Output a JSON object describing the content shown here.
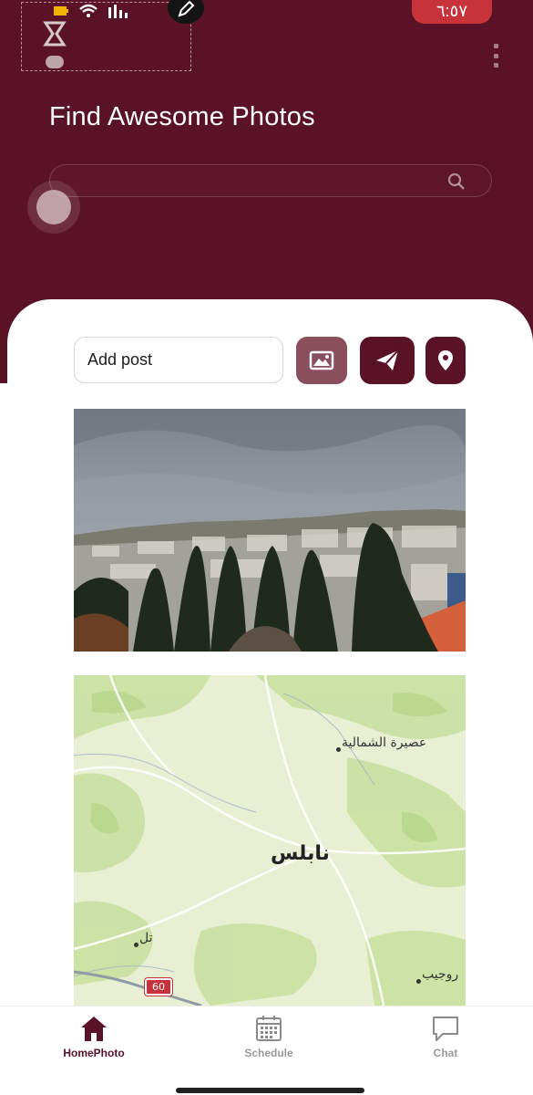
{
  "status_bar": {
    "time": "٦:٥٧",
    "icons": [
      "battery-icon",
      "wifi-icon",
      "signal-icon"
    ]
  },
  "header": {
    "title": "Find Awesome Photos",
    "search": {
      "value": "",
      "placeholder": ""
    },
    "background_color": "#5a1226"
  },
  "composer": {
    "post_placeholder": "Add post",
    "buttons": [
      {
        "icon": "image-icon",
        "color": "#8a4e5c"
      },
      {
        "icon": "send-icon",
        "color": "#5a1226"
      },
      {
        "icon": "location-icon",
        "color": "#5a1226"
      }
    ]
  },
  "map": {
    "labels": {
      "city": "نابلس",
      "north": "عصيرة الشمالية",
      "west": "تل",
      "east": "روجيب",
      "road_shield": "60"
    }
  },
  "bottom_nav": {
    "items": [
      {
        "label": "HomePhoto",
        "icon": "home-icon",
        "active": true
      },
      {
        "label": "Schedule",
        "icon": "calendar-icon",
        "active": false
      },
      {
        "label": "Chat",
        "icon": "chat-bubble-icon",
        "active": false
      }
    ]
  },
  "colors": {
    "primary": "#5a1226",
    "secondary": "#8a4e5c",
    "status_time_bg": "#c8323a"
  }
}
